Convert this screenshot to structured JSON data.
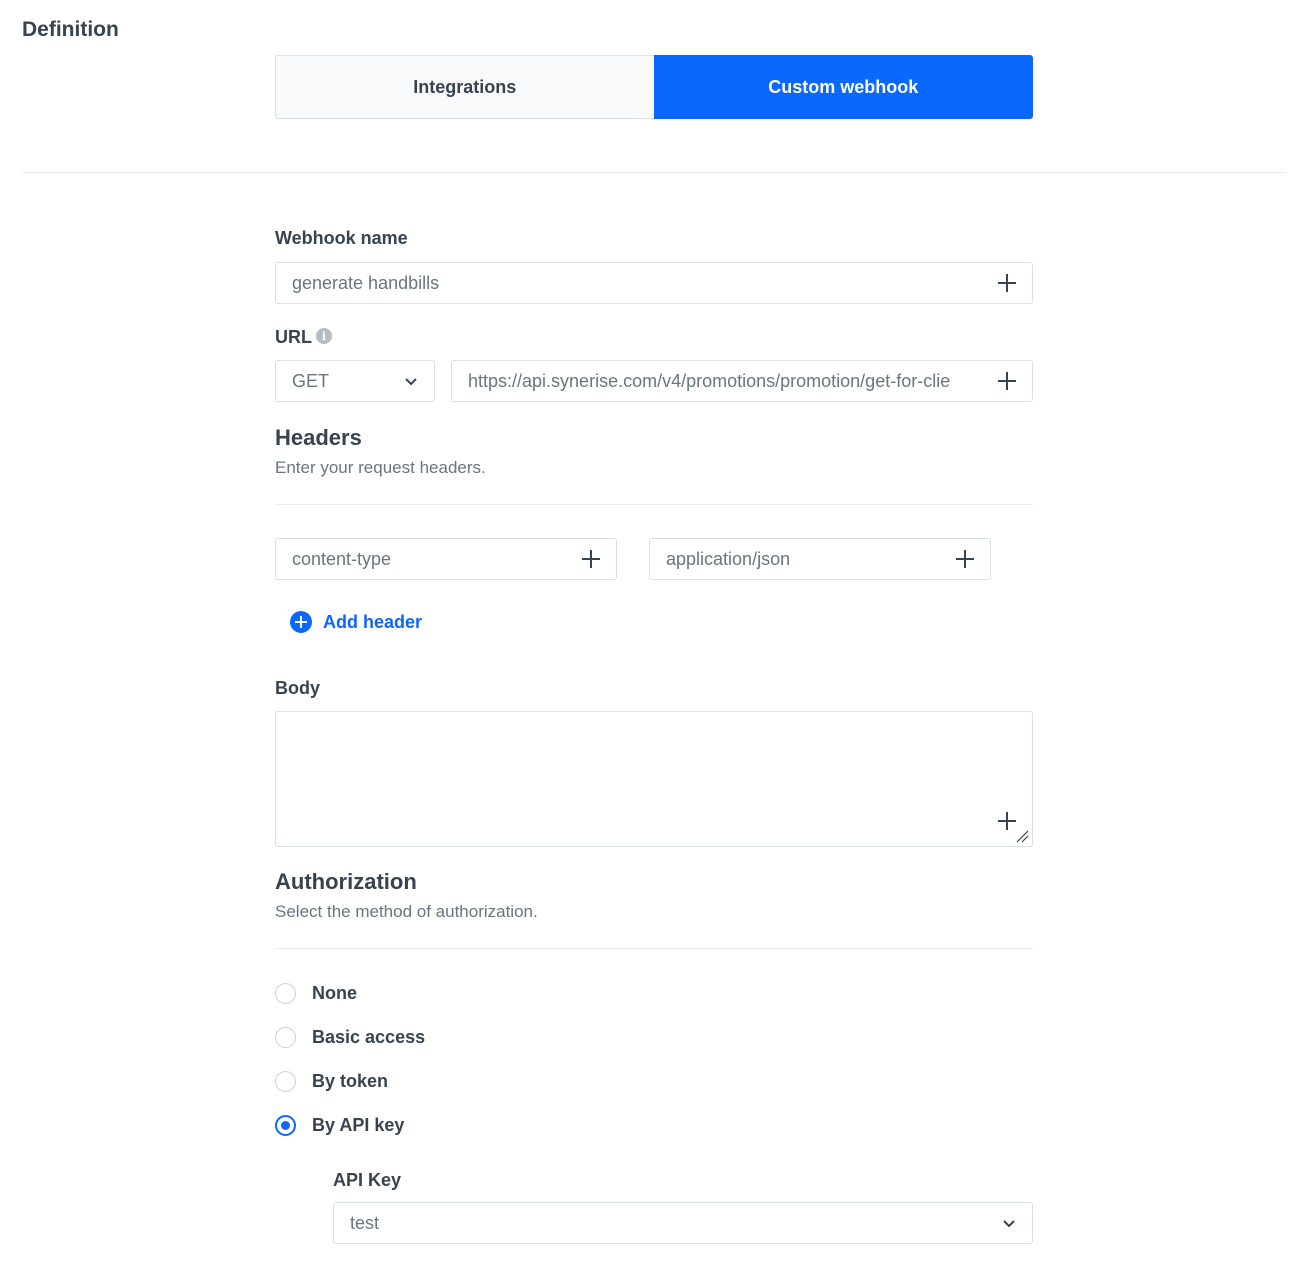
{
  "section": {
    "title": "Definition"
  },
  "tabs": [
    {
      "label": "Integrations",
      "active": false
    },
    {
      "label": "Custom webhook",
      "active": true
    }
  ],
  "webhook_name": {
    "label": "Webhook name",
    "value": "generate handbills"
  },
  "url": {
    "label": "URL",
    "method": "GET",
    "value": "https://api.synerise.com/v4/promotions/promotion/get-for-clie"
  },
  "headers": {
    "title": "Headers",
    "description": "Enter your request headers.",
    "rows": [
      {
        "key": "content-type",
        "value": "application/json"
      }
    ],
    "add_label": "Add header"
  },
  "body": {
    "label": "Body",
    "value": ""
  },
  "authorization": {
    "title": "Authorization",
    "description": "Select the method of authorization.",
    "options": [
      {
        "label": "None",
        "selected": false
      },
      {
        "label": "Basic access",
        "selected": false
      },
      {
        "label": "By token",
        "selected": false
      },
      {
        "label": "By API key",
        "selected": true
      }
    ]
  },
  "api_key": {
    "label": "API Key",
    "value": "test"
  },
  "colors": {
    "accent": "#0b68ff",
    "text": "#384350",
    "muted": "#6a7580",
    "border": "#dbe0e3"
  },
  "icons": {
    "field_action": "plus-icon",
    "select": "chevron-down-icon",
    "info": "info-icon",
    "add": "plus-circle-icon"
  }
}
